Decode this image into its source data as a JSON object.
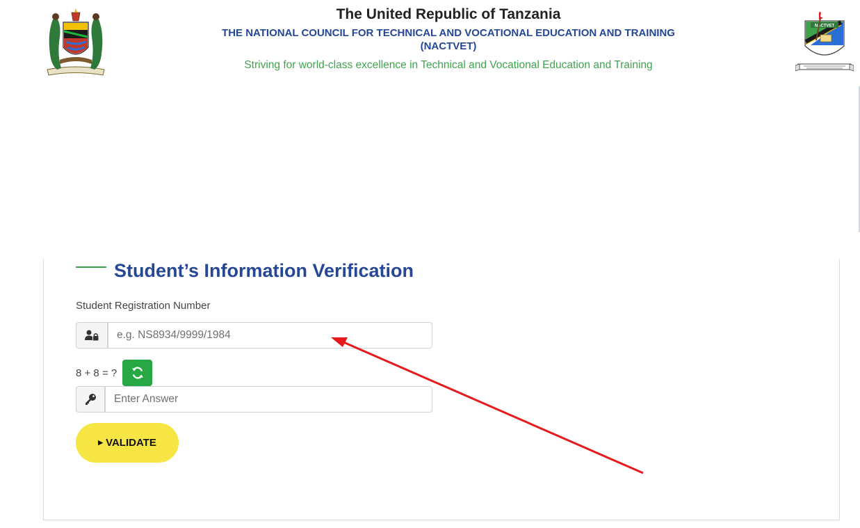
{
  "header": {
    "republic_title": "The United Republic of Tanzania",
    "council_title": "THE NATIONAL COUNCIL FOR TECHNICAL AND VOCATIONAL EDUCATION AND TRAINING",
    "council_abbr": "(NACTVET)",
    "motto": "Striving for world-class excellence in Technical and Vocational Education and Training",
    "left_logo": "coat-of-arms-icon",
    "right_logo": "nactvet-logo-icon",
    "right_logo_text": "NACTVET"
  },
  "form": {
    "title": "Student’s Information Verification",
    "registration_label": "Student Registration Number",
    "registration_placeholder": "e.g. NS8934/9999/1984",
    "registration_value": "",
    "registration_icon": "user-lock-icon",
    "captcha_question": "8 + 8 = ?",
    "refresh_icon": "refresh-icon",
    "answer_placeholder": "Enter Answer",
    "answer_value": "",
    "answer_icon": "key-icon",
    "validate_label": "VALIDATE"
  },
  "colors": {
    "brand_blue": "#264796",
    "brand_green": "#3fa34d",
    "refresh_green": "#28a745",
    "validate_yellow": "#f7e543",
    "annotation_red": "#e8191c"
  }
}
